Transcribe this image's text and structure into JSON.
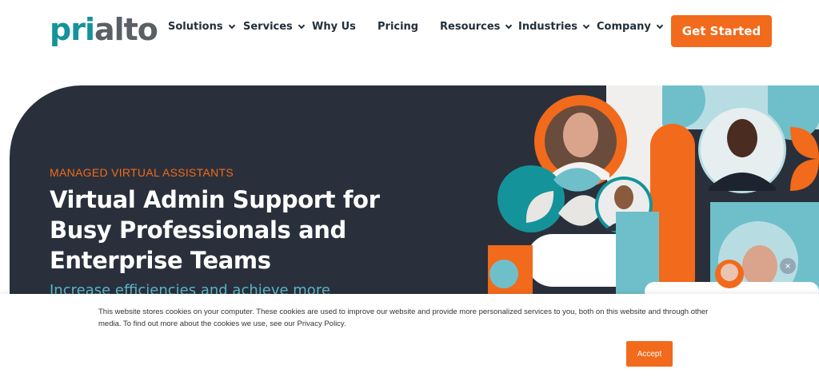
{
  "header": {
    "logo": {
      "part1": "pri",
      "part2": "alto"
    },
    "nav": [
      {
        "label": "Solutions",
        "has_dropdown": true
      },
      {
        "label": "Services",
        "has_dropdown": true
      },
      {
        "label": "Why Us",
        "has_dropdown": false
      },
      {
        "label": "Pricing",
        "has_dropdown": false
      },
      {
        "label": "Resources",
        "has_dropdown": true
      },
      {
        "label": "Industries",
        "has_dropdown": true
      },
      {
        "label": "Company",
        "has_dropdown": true
      }
    ],
    "cta_label": "Get Started"
  },
  "hero": {
    "eyebrow": "MANAGED VIRTUAL ASSISTANTS",
    "headline": "Virtual Admin Support for Busy Professionals and Enterprise Teams",
    "subhead": "Increase efficiencies and achieve more"
  },
  "chat_widget": {
    "close_glyph": "×",
    "icon": "close-icon"
  },
  "cookie_banner": {
    "text": "This website stores cookies on your computer. These cookies are used to improve our website and provide more personalized services to you, both on this website and through other media. To find out more about the cookies we use, see our Privacy Policy.",
    "accept_label": "Accept"
  },
  "colors": {
    "brand_teal": "#14939a",
    "brand_orange": "#f26a1b",
    "hero_dark": "#2a303b",
    "light_teal": "#6fbfca",
    "pale_teal": "#b7dde3"
  }
}
